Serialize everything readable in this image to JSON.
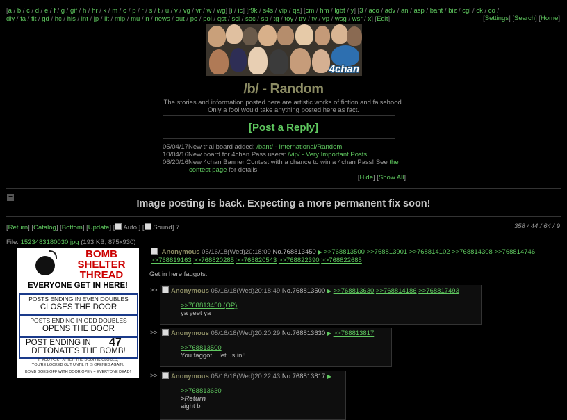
{
  "nav": {
    "boards_line1": [
      "a",
      "b",
      "c",
      "d",
      "e",
      "f",
      "g",
      "gif",
      "h",
      "hr",
      "k",
      "m",
      "o",
      "p",
      "r",
      "s",
      "t",
      "u",
      "v",
      "vg",
      "vr",
      "w",
      "wg"
    ],
    "boards_line1b": [
      "i",
      "ic"
    ],
    "boards_line1c": [
      "r9k",
      "s4s",
      "vip",
      "qa"
    ],
    "boards_line1d": [
      "cm",
      "hm",
      "lgbt",
      "y"
    ],
    "boards_line1e": [
      "3",
      "aco",
      "adv",
      "an",
      "asp",
      "bant",
      "biz",
      "cgl",
      "ck"
    ],
    "boards_line2": [
      "co",
      "diy",
      "fa",
      "fit",
      "gd",
      "hc",
      "his",
      "int",
      "jp",
      "lit",
      "mlp",
      "mu",
      "n",
      "news",
      "out",
      "po",
      "pol",
      "qst",
      "sci",
      "soc",
      "sp",
      "tg",
      "toy",
      "trv",
      "tv",
      "vp",
      "wsg",
      "wsr",
      "x"
    ],
    "edit": "Edit",
    "settings": "Settings",
    "search": "Search",
    "home": "Home"
  },
  "banner": {
    "logo": "4chan"
  },
  "board": {
    "title": "/b/ - Random",
    "subtitle_line1": "The stories and information posted here are artistic works of fiction and falsehood.",
    "subtitle_line2": "Only a fool would take anything posted here as fact."
  },
  "post_reply": "Post a Reply",
  "news": [
    {
      "date": "05/04/17",
      "text": "New trial board added: ",
      "link": "/bant/ - International/Random",
      "after": ""
    },
    {
      "date": "10/04/16",
      "text": "New board for 4chan Pass users: ",
      "link": "/vip/ - Very Important Posts",
      "after": ""
    },
    {
      "date": "06/20/16",
      "text": "New 4chan Banner Contest with a chance to win a 4chan Pass! See ",
      "link": "the contest page",
      "after": " for details."
    }
  ],
  "news_hide": "Hide",
  "news_show_all": "Show All",
  "announcement": "Image posting is back. Expecting a more permanent fix soon!",
  "thread_nav": {
    "return": "Return",
    "catalog": "Catalog",
    "bottom": "Bottom",
    "update": "Update",
    "auto": "Auto",
    "sound": "Sound",
    "count": "7"
  },
  "stats": "358 / 44 / 64 / 9",
  "op": {
    "file_label": "File: ",
    "file_name": "1523483180030.jpg",
    "file_meta": " (193 KB, 875x930)",
    "name": "Anonymous",
    "date": "05/16/18(Wed)20:18:09",
    "no_label": "No.",
    "no": "768813450",
    "backlinks_line1": [
      ">>768813500",
      ">>768813901",
      ">>768814102",
      ">>768814308",
      ">>768814746"
    ],
    "backlinks_line2": [
      ">>768819163",
      ">>768820285",
      ">>768820543",
      ">>768822390",
      ">>768822685"
    ],
    "comment": "Get in here faggots.",
    "image": {
      "title1": "BOMB",
      "title2": "SHELTER",
      "title3": "THREAD",
      "headline": "EVERYONE GET IN HERE!",
      "box1a": "POSTS ENDING IN EVEN DOUBLES",
      "box1b": "CLOSES THE DOOR",
      "box2a": "POSTS ENDING IN ODD DOUBLES",
      "box2b": "OPENS THE DOOR",
      "box3a": "POST ENDING IN",
      "box3num": "47",
      "box3b": "DETONATES THE BOMB!",
      "fine1": "IF YOU POST AFTER THE DOOR IS CLOSED,",
      "fine2": "YOU'RE LOCKED OUT UNTIL IT IS OPENED AGAIN.",
      "fine3": "BOMB GOES OFF WITH DOOR OPEN = EVERYONE DEAD!"
    }
  },
  "replies": [
    {
      "side": ">>",
      "name": "Anonymous",
      "date": "05/16/18(Wed)20:18:49",
      "no_label": "No.",
      "no": "768813500",
      "backlinks": [
        ">>768813630",
        ">>768814186",
        ">>768817493"
      ],
      "quote": ">>768813450 (OP)",
      "greentext": "",
      "body": "ya yeet ya"
    },
    {
      "side": ">>",
      "name": "Anonymous",
      "date": "05/16/18(Wed)20:20:29",
      "no_label": "No.",
      "no": "768813630",
      "backlinks": [
        ">>768813817"
      ],
      "quote": ">>768813500",
      "greentext": "",
      "body": "You faggot... let us in!!"
    },
    {
      "side": ">>",
      "name": "Anonymous",
      "date": "05/16/18(Wed)20:22:43",
      "no_label": "No.",
      "no": "768813817",
      "backlinks": [],
      "quote": ">>768813630",
      "greentext": ">Return",
      "body": "aight b"
    }
  ]
}
